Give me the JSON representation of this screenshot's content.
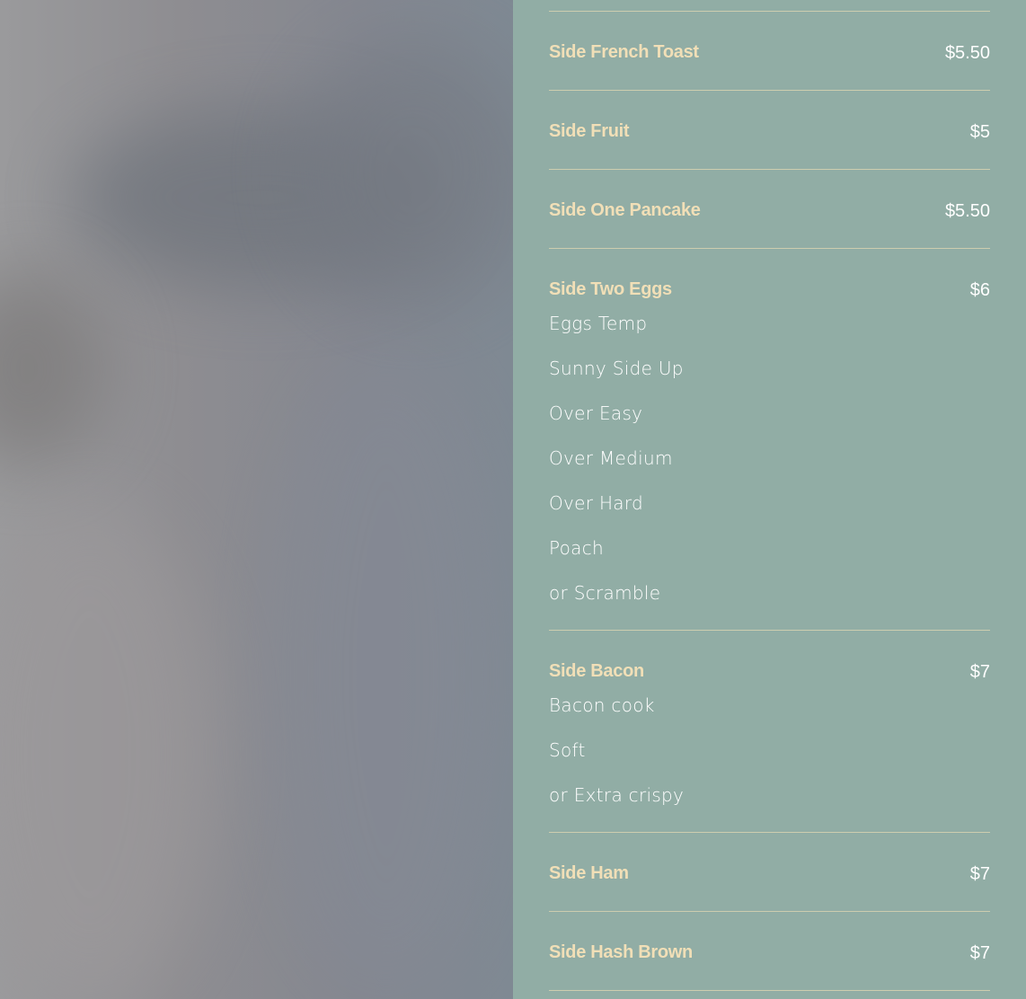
{
  "menu": {
    "items": [
      {
        "name": "Side French Toast",
        "price": "$5.50",
        "options": []
      },
      {
        "name": "Side Fruit",
        "price": "$5",
        "options": []
      },
      {
        "name": "Side One Pancake",
        "price": "$5.50",
        "options": []
      },
      {
        "name": "Side Two Eggs",
        "price": "$6",
        "options": [
          "Eggs Temp",
          "Sunny Side Up",
          "Over Easy",
          "Over Medium",
          "Over Hard",
          "Poach",
          "or Scramble"
        ]
      },
      {
        "name": "Side Bacon",
        "price": "$7",
        "options": [
          "Bacon cook",
          "Soft",
          "or Extra crispy"
        ]
      },
      {
        "name": "Side Ham",
        "price": "$7",
        "options": []
      },
      {
        "name": "Side Hash Brown",
        "price": "$7",
        "options": []
      }
    ]
  },
  "colors": {
    "panel_background": "#91ada5",
    "item_name": "#f1dfb7",
    "price": "#ffffff",
    "divider": "#d7d2b0"
  }
}
